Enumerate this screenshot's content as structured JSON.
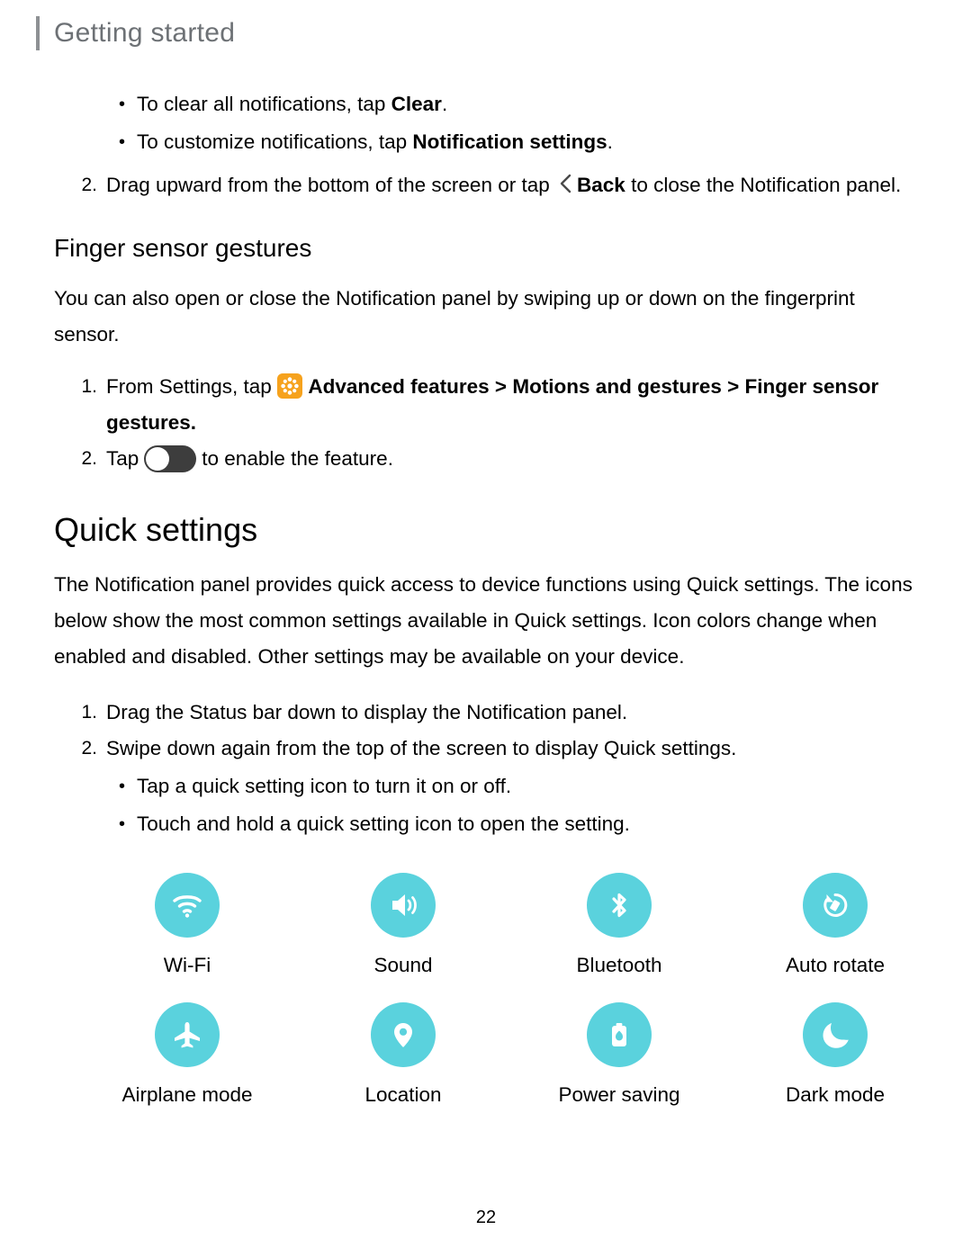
{
  "header": {
    "title": "Getting started"
  },
  "notifications": {
    "bullet_1_pre": "To clear all notifications, tap ",
    "bullet_1_bold": "Clear",
    "bullet_1_post": ".",
    "bullet_2_pre": "To customize notifications, tap ",
    "bullet_2_bold": "Notification settings",
    "bullet_2_post": ".",
    "step2_num": "2.",
    "step2_pre": "Drag upward from the bottom of the screen or tap",
    "step2_bold": "Back",
    "step2_post": " to close the Notification panel."
  },
  "finger_sensor": {
    "heading": "Finger sensor gestures",
    "body": "You can also open or close the Notification panel by swiping up or down on the fingerprint sensor.",
    "step1_num": "1.",
    "step1_pre": "From Settings, tap ",
    "step1_bold_1": "Advanced features",
    "step1_sep_1": " > ",
    "step1_bold_2": "Motions and gestures",
    "step1_sep_2": " > ",
    "step1_bold_3": "Finger sensor gestures",
    "step1_post": ".",
    "step2_num": "2.",
    "step2_pre": "Tap",
    "step2_post": "to enable the feature."
  },
  "quick_settings": {
    "heading": "Quick settings",
    "body": "The Notification panel provides quick access to device functions using Quick settings. The icons below show the most common settings available in Quick settings. Icon colors change when enabled and disabled. Other settings may be available on your device.",
    "step1_num": "1.",
    "step1_text": "Drag the Status bar down to display the Notification panel.",
    "step2_num": "2.",
    "step2_text": "Swipe down again from the top of the screen to display Quick settings.",
    "bullet_1": "Tap a quick setting icon to turn it on or off.",
    "bullet_2": "Touch and hold a quick setting icon to open the setting.",
    "icon_color": "#5ad2dd",
    "tiles": [
      {
        "label": "Wi-Fi",
        "icon": "wifi-icon"
      },
      {
        "label": "Sound",
        "icon": "sound-icon"
      },
      {
        "label": "Bluetooth",
        "icon": "bluetooth-icon"
      },
      {
        "label": "Auto rotate",
        "icon": "auto-rotate-icon"
      },
      {
        "label": "Airplane mode",
        "icon": "airplane-icon"
      },
      {
        "label": "Location",
        "icon": "location-pin-icon"
      },
      {
        "label": "Power saving",
        "icon": "power-saving-icon"
      },
      {
        "label": "Dark mode",
        "icon": "moon-icon"
      }
    ]
  },
  "footer": {
    "page_number": "22"
  }
}
